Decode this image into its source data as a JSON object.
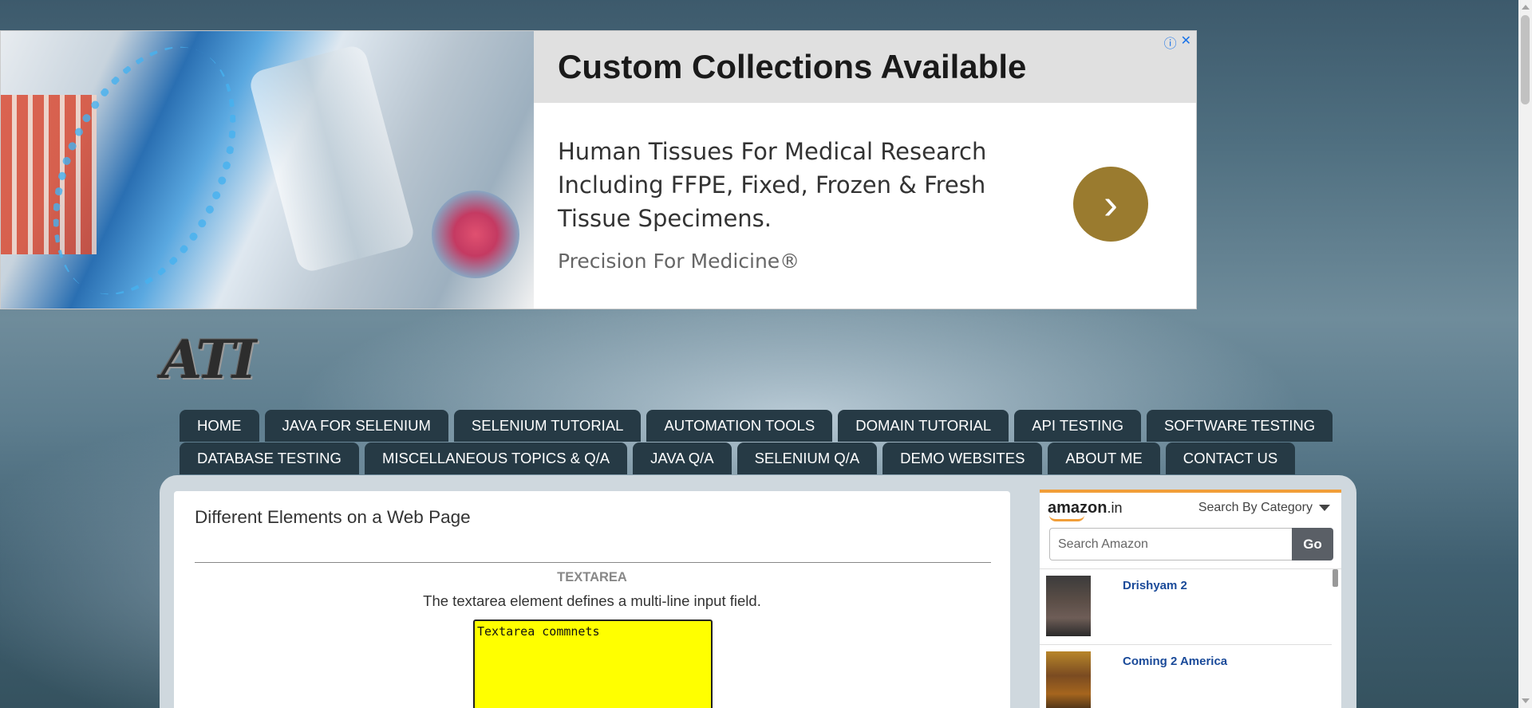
{
  "ad": {
    "headline": "Custom Collections Available",
    "body": "Human Tissues For Medical Research Including FFPE, Fixed, Frozen & Fresh Tissue Specimens.",
    "sponsor": "Precision For Medicine®",
    "info_icon": "ⓘ",
    "close_icon": "✕",
    "arrow_icon": "›"
  },
  "logo": {
    "text": "ATI"
  },
  "nav": {
    "row1": [
      "HOME",
      "JAVA FOR SELENIUM",
      "SELENIUM TUTORIAL",
      "AUTOMATION TOOLS",
      "DOMAIN TUTORIAL",
      "API TESTING",
      "SOFTWARE TESTING"
    ],
    "row2": [
      "DATABASE TESTING",
      "MISCELLANEOUS TOPICS & Q/A",
      "JAVA Q/A",
      "SELENIUM Q/A",
      "DEMO WEBSITES",
      "ABOUT ME",
      "CONTACT US"
    ]
  },
  "post": {
    "title": "Different Elements on a Web Page",
    "section_title": "TEXTAREA",
    "section_desc": "The textarea element defines a multi-line input field.",
    "textarea_value": "Textarea commnets"
  },
  "widget": {
    "brand": "amazon",
    "tld": ".in",
    "category_label": "Search By Category",
    "search_placeholder": "Search Amazon",
    "go_label": "Go",
    "items": [
      {
        "name": "Drishyam 2"
      },
      {
        "name": "Coming 2 America"
      }
    ]
  },
  "colors": {
    "nav_bg": "#263a45",
    "textarea_bg": "#ffff00",
    "ad_arrow": "#9a7b2f",
    "amazon_accent": "#f19e39",
    "link": "#1a4a99"
  }
}
